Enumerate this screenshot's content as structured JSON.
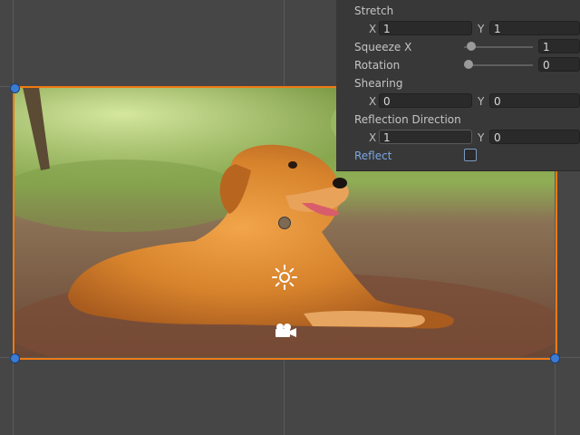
{
  "inspector": {
    "stretch": {
      "label": "Stretch",
      "x_axis": "X",
      "x_value": "1",
      "y_axis": "Y",
      "y_value": "1"
    },
    "squeeze_x": {
      "label": "Squeeze X",
      "value": "1",
      "level": 0.05
    },
    "rotation": {
      "label": "Rotation",
      "value": "0",
      "level": 0
    },
    "shearing": {
      "label": "Shearing",
      "x_axis": "X",
      "x_value": "0",
      "y_axis": "Y",
      "y_value": "0"
    },
    "reflection_direction": {
      "label": "Reflection Direction",
      "x_axis": "X",
      "x_value": "1",
      "y_axis": "Y",
      "y_value": "0"
    },
    "reflect": {
      "label": "Reflect",
      "checked": false
    }
  },
  "scene": {
    "selected_object": "dog-photo",
    "selection_color": "#f07a12",
    "handle_color": "#3b7bd4",
    "gizmos": [
      "pivot-icon",
      "sun-icon",
      "camera-icon"
    ]
  },
  "colors": {
    "panel_bg": "#383838",
    "scene_bg": "#464646",
    "reflect_label": "#7aa6e0"
  }
}
